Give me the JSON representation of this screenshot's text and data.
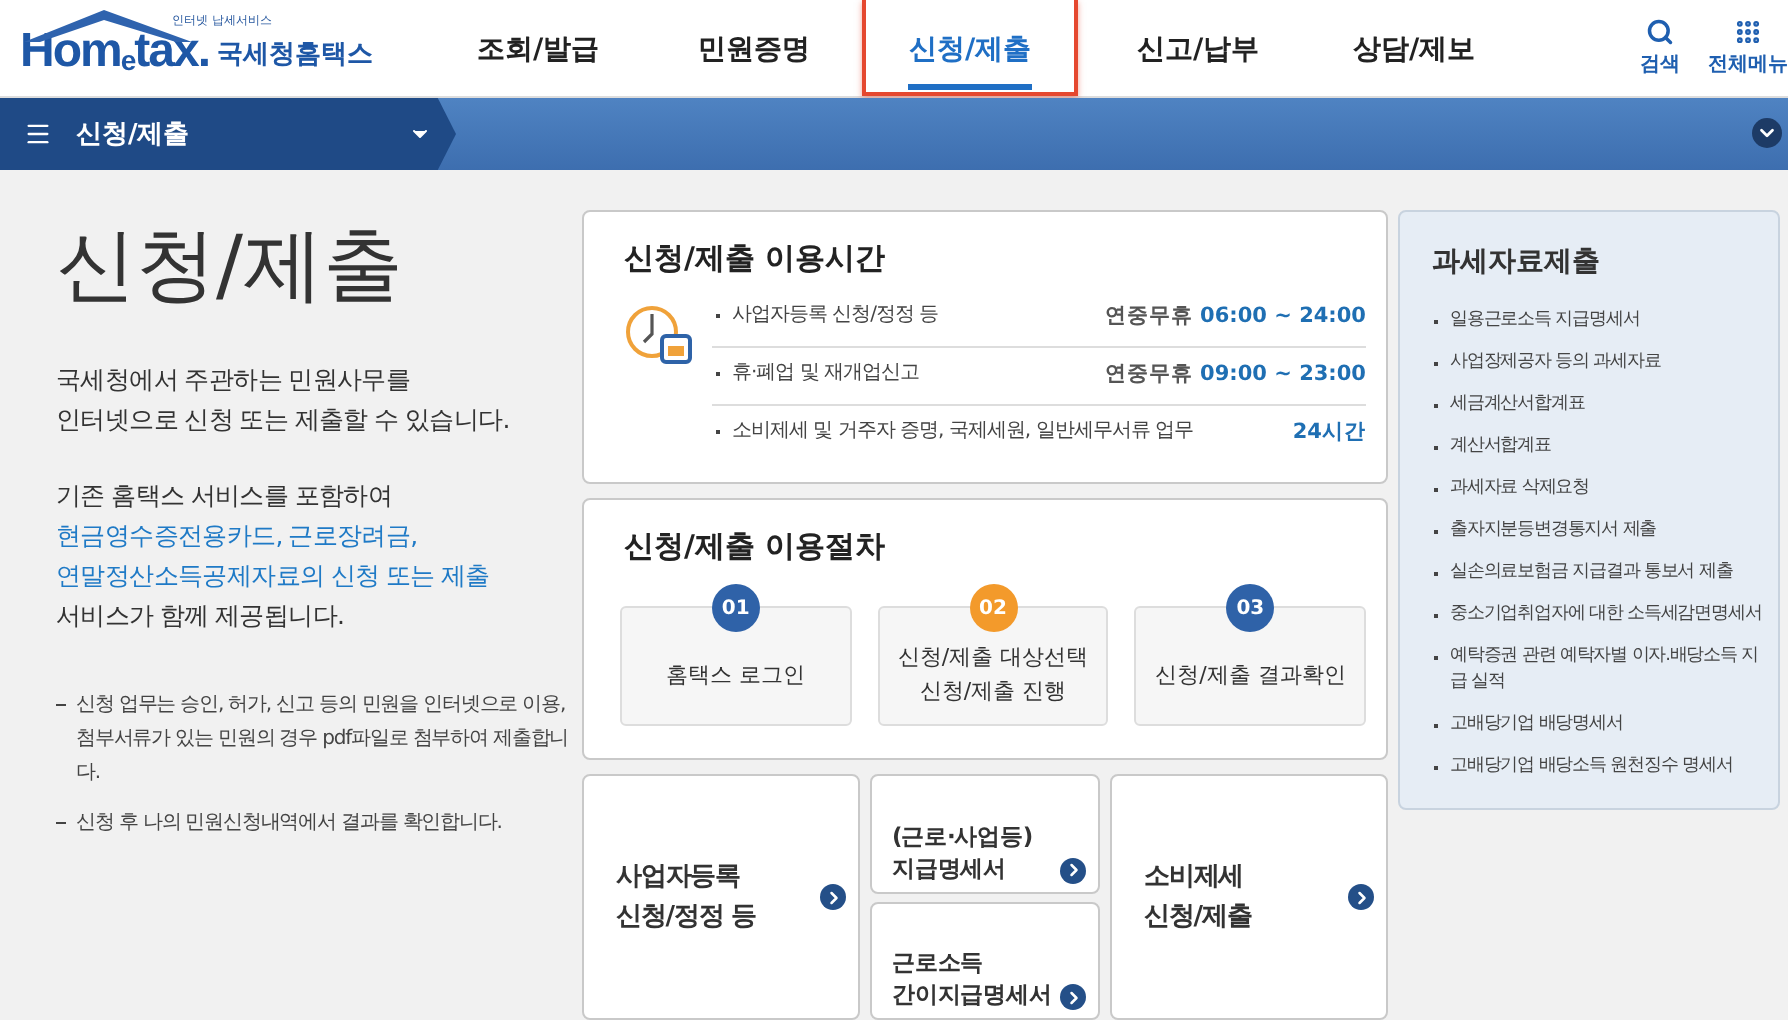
{
  "header": {
    "logo": {
      "tagline": "인터넷 납세서비스",
      "wordmark": "Hom$_{e}$tax.",
      "name": "국세청홈택스"
    },
    "nav": [
      {
        "label": "조회/발급",
        "selected": false
      },
      {
        "label": "민원증명",
        "selected": false
      },
      {
        "label": "신청/제출",
        "selected": true
      },
      {
        "label": "신고/납부",
        "selected": false
      },
      {
        "label": "상담/제보",
        "selected": false
      }
    ],
    "actions": [
      {
        "kind": "search",
        "label": "검색"
      },
      {
        "kind": "menu",
        "label": "전체메뉴"
      }
    ]
  },
  "breadcrumb": {
    "label": "신청/제출"
  },
  "intro": {
    "title": "신청/제출",
    "paragraphs": [
      [
        {
          "text": "국세청에서 주관하는 민원사무를",
          "highlight": false
        },
        {
          "text": "인터넷으로 신청 또는 제출할 수 있습니다.",
          "highlight": false
        }
      ],
      [
        {
          "text": "기존 홈택스 서비스를 포함하여",
          "highlight": false
        },
        {
          "text": "현금영수증전용카드, 근로장려금,",
          "highlight": true
        },
        {
          "text": "연말정산소득공제자료의 신청 또는 제출",
          "highlight": true
        },
        {
          "text": "서비스가 함께 제공됩니다.",
          "highlight": false
        }
      ]
    ],
    "notes": [
      "신청 업무는 승인, 허가, 신고 등의 민원을 인터넷으로 이용, 첨부서류가 있는 민원의 경우 pdf파일로 첨부하여 제출합니다.",
      "신청 후 나의 민원신청내역에서 결과를 확인합니다."
    ]
  },
  "hours": {
    "title": "신청/제출 이용시간",
    "rows": [
      {
        "label": "사업자등록 신청/정정 등",
        "prefix": "연중무휴",
        "time": "06:00 ~ 24:00"
      },
      {
        "label": "휴·폐업 및 재개업신고",
        "prefix": "연중무휴",
        "time": "09:00 ~ 23:00"
      },
      {
        "label": "소비제세 및 거주자 증명, 국제세원, 일반세무서류 업무",
        "time": "24시간"
      }
    ]
  },
  "procedure": {
    "title": "신청/제출 이용절차",
    "steps": [
      {
        "number": "01",
        "color": "#2f62a8",
        "lines": [
          "홈택스 로그인"
        ]
      },
      {
        "number": "02",
        "color": "#f39a2b",
        "lines": [
          "신청/제출 대상선택",
          "신청/제출 진행"
        ]
      },
      {
        "number": "03",
        "color": "#2f62a8",
        "lines": [
          "신청/제출 결과확인"
        ]
      }
    ]
  },
  "shortcuts": [
    {
      "kind": "single",
      "lines": [
        "사업자등록",
        "신청/정정 등"
      ]
    },
    {
      "kind": "stack",
      "items": [
        {
          "lines": [
            "(근로·사업등)",
            "지급명세서"
          ]
        },
        {
          "lines": [
            "근로소득",
            "간이지급명세서"
          ]
        }
      ]
    },
    {
      "kind": "single",
      "lines": [
        "소비제세",
        "신청/제출"
      ]
    }
  ],
  "side": {
    "title": "과세자료제출",
    "items": [
      "일용근로소득 지급명세서",
      "사업장제공자 등의 과세자료",
      "세금계산서합계표",
      "계산서합계표",
      "과세자료 삭제요청",
      "출자지분등변경통지서 제출",
      "실손의료보험금 지급결과 통보서 제출",
      "중소기업취업자에 대한 소득세감면명세서",
      "예탁증권 관련 예탁자별 이자.배당소득 지급 실적",
      "고배당기업 배당명세서",
      "고배당기업 배당소득 원천징수 명세서"
    ]
  }
}
